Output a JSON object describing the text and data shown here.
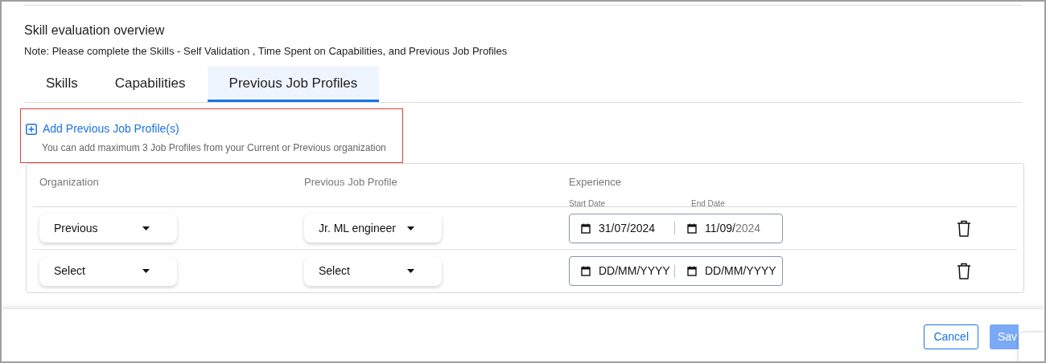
{
  "title": "Skill evaluation overview",
  "note": "Note: Please complete the Skills - Self Validation , Time Spent on Capabilities, and Previous Job Profiles",
  "tabs": [
    {
      "label": "Skills",
      "selected": false
    },
    {
      "label": "Capabilities",
      "selected": false
    },
    {
      "label": "Previous Job Profiles",
      "selected": true
    }
  ],
  "add_link": "Add Previous Job Profile(s)",
  "add_hint": "You can add maximum 3 Job Profiles from your Current or Previous organization",
  "table": {
    "columns": [
      "Organization",
      "Previous Job Profile",
      "Experience"
    ],
    "sub_columns": [
      "Start Date",
      "End Date"
    ],
    "rows": [
      {
        "organization": "Previous",
        "job_profile": "Jr. ML engineer",
        "start_date": "31/07/2024",
        "end_date": "11/09/",
        "end_date_hint": "2024"
      },
      {
        "organization": "Select",
        "job_profile": "Select",
        "start_placeholder": "DD/MM/YYYY",
        "end_placeholder": "DD/MM/YYYY"
      }
    ]
  },
  "buttons": [
    {
      "label": "Cancel",
      "kind": "outline"
    },
    {
      "label": "Sav",
      "kind": "primary"
    }
  ]
}
